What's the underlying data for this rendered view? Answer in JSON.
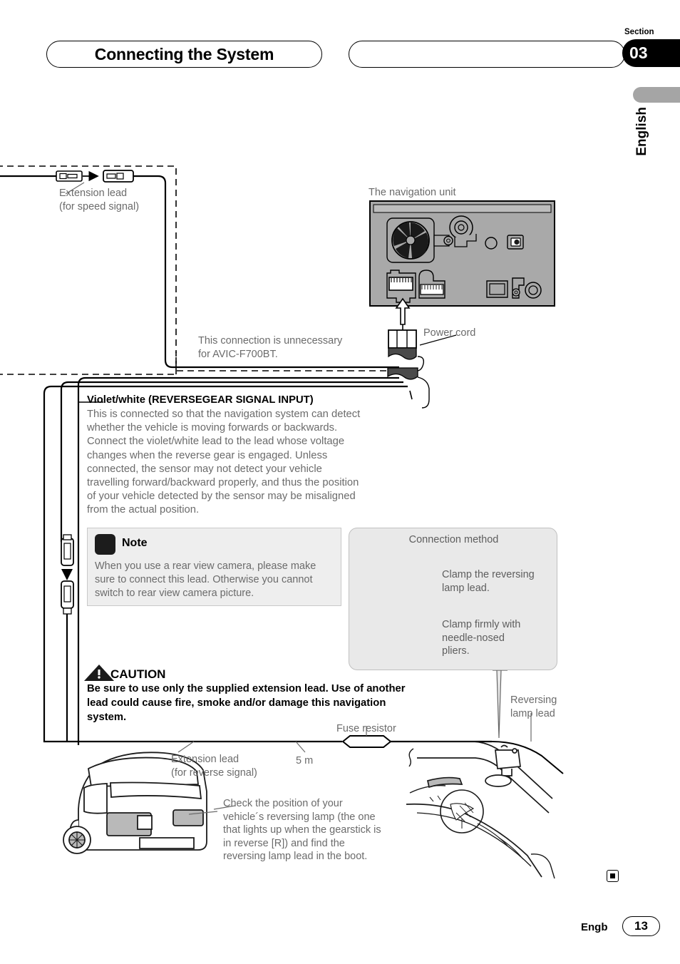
{
  "header": {
    "title": "Connecting the System",
    "section_word": "Section",
    "section_number": "03",
    "language_vertical": "English"
  },
  "diagram": {
    "extension_lead_speed": "Extension lead\n(for speed signal)",
    "navigation_unit": "The navigation unit",
    "unnecessary_note": "This connection is unnecessary\nfor AVIC-F700BT.",
    "power_cord": "Power cord",
    "extension_lead_reverse": "Extension lead\n(for reverse signal)",
    "length_label": "5 m",
    "fuse_resistor": "Fuse resistor",
    "reversing_lamp_lead": "Reversing\nlamp lead",
    "check_position": "Check the position of your\nvehicle´s reversing lamp (the one\nthat lights up when the gearstick is\nin reverse [R]) and find the\nreversing lamp lead in the boot."
  },
  "violet_section": {
    "heading": "Violet/white (REVERSEGEAR SIGNAL INPUT)",
    "body": "This is connected so that the navigation system can detect\nwhether the vehicle is moving forwards or backwards.\nConnect the violet/white lead to the lead whose voltage\nchanges when the reverse gear is engaged. Unless\nconnected, the sensor may not detect your vehicle\ntravelling forward/backward properly, and thus the position\nof your vehicle detected by the sensor may be misaligned\nfrom the actual position."
  },
  "note": {
    "title": "Note",
    "body": "When you use a rear view camera, please make\nsure to connect this lead. Otherwise you cannot\nswitch to rear view camera picture."
  },
  "connection_method": {
    "title": "Connection method",
    "step1": "Clamp the reversing\nlamp lead.",
    "step2": "Clamp firmly with\nneedle-nosed\npliers."
  },
  "caution": {
    "title": "CAUTION",
    "body": "Be sure to use only the supplied extension lead. Use of another\nlead could cause fire, smoke and/or damage this navigation\nsystem."
  },
  "footer": {
    "language_code": "Engb",
    "page_number": "13"
  },
  "colors": {
    "label_gray": "#6b6b6b",
    "panel_gray": "#a9a9a9",
    "box_gray": "#e9e9e9",
    "accent_black": "#000000"
  }
}
